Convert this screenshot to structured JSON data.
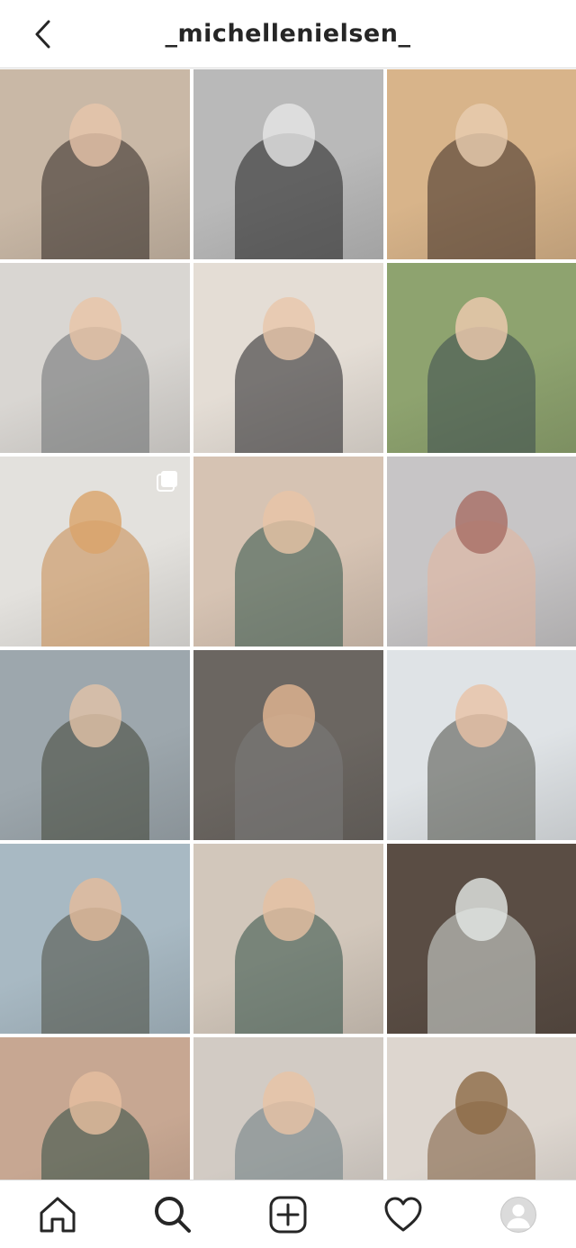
{
  "header": {
    "username": "_michellenielsen_",
    "back_icon": "chevron-left-icon"
  },
  "grid": {
    "tiles": [
      {
        "bg": "#c9b8a6",
        "fig": "#2b2421",
        "face": "#e7c6ab",
        "multi": false
      },
      {
        "bg": "#b9b9b9",
        "fig": "#1c1c1c",
        "face": "#e6e6e6",
        "multi": false
      },
      {
        "bg": "#d8b48a",
        "fig": "#3a2a22",
        "face": "#e8cdb0",
        "multi": false
      },
      {
        "bg": "#d9d6d2",
        "fig": "#6a6e70",
        "face": "#e9c4a6",
        "multi": false
      },
      {
        "bg": "#e4ddd5",
        "fig": "#1f1f22",
        "face": "#e8c7aa",
        "multi": false
      },
      {
        "bg": "#8ea36f",
        "fig": "#3a4a4f",
        "face": "#f0cbb0",
        "multi": false
      },
      {
        "bg": "#e3e1dd",
        "fig": "#c98a4d",
        "face": "#d9a46a",
        "multi": true
      },
      {
        "bg": "#d6c3b3",
        "fig": "#2f5247",
        "face": "#e8c4a6",
        "multi": false
      },
      {
        "bg": "#c7c5c6",
        "fig": "#e3b59c",
        "face": "#a86d64",
        "multi": false
      },
      {
        "bg": "#9da7ad",
        "fig": "#3f4435",
        "face": "#e2c3a8",
        "multi": false
      },
      {
        "bg": "#6b6661",
        "fig": "#7c7c7c",
        "face": "#e4b692",
        "multi": false
      },
      {
        "bg": "#dfe3e6",
        "fig": "#4d4f45",
        "face": "#e8c2a6",
        "multi": false
      },
      {
        "bg": "#a8b9c3",
        "fig": "#4a4d3f",
        "face": "#e5bb9b",
        "multi": false
      },
      {
        "bg": "#d2c7bb",
        "fig": "#2d4c44",
        "face": "#e6c0a3",
        "multi": false
      },
      {
        "bg": "#5a4d44",
        "fig": "#d9e0dc",
        "face": "#e4e9e6",
        "multi": false
      },
      {
        "bg": "#c7a792",
        "fig": "#2c4a41",
        "face": "#e6bfa0",
        "multi": false
      },
      {
        "bg": "#d2cbc4",
        "fig": "#6a7b82",
        "face": "#e8c3a5",
        "multi": false
      },
      {
        "bg": "#ddd6cf",
        "fig": "#7a5a3a",
        "face": "#8d6a45",
        "multi": false
      }
    ],
    "partial_tiles": [
      {
        "bg": "#8d8f93"
      },
      {
        "bg": "#7b5f4f"
      },
      {
        "bg": "#b79a86"
      }
    ]
  },
  "bottom_nav": {
    "items": [
      {
        "name": "home-icon"
      },
      {
        "name": "search-icon"
      },
      {
        "name": "new-post-icon"
      },
      {
        "name": "activity-heart-icon"
      },
      {
        "name": "profile-avatar-icon"
      }
    ]
  },
  "colors": {
    "border": "#dbdbdb",
    "text": "#262626"
  }
}
